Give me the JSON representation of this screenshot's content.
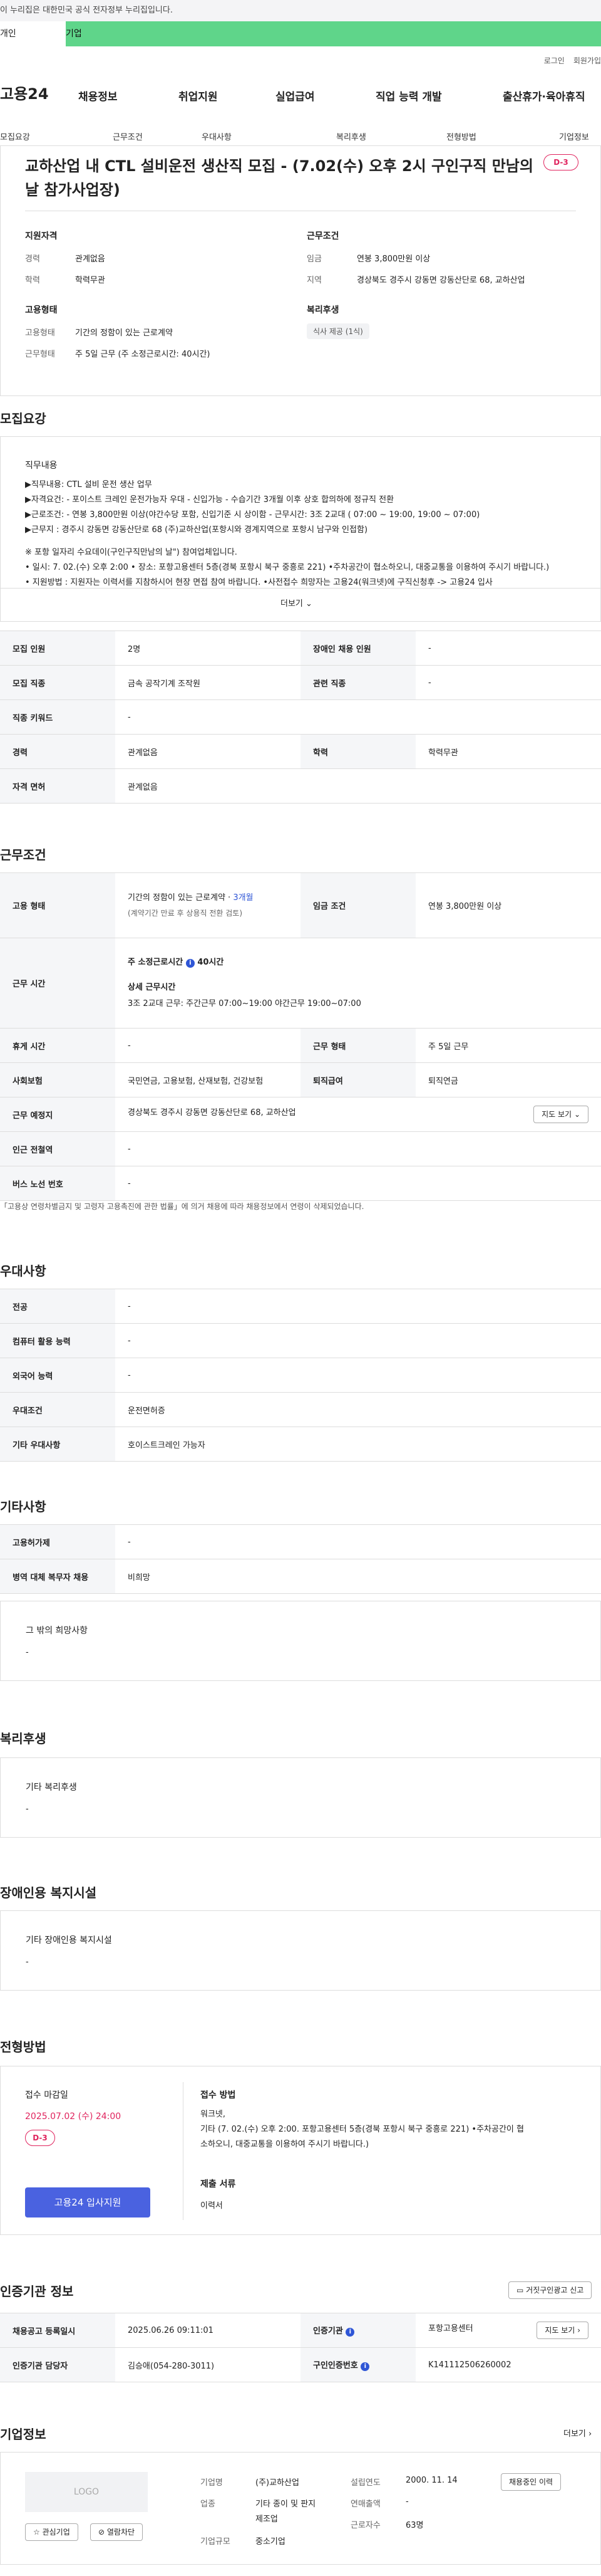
{
  "gov_banner": "이 누리집은 대한민국 공식 전자정부 누리집입니다.",
  "top_tabs": [
    "개인",
    "기업"
  ],
  "util_links": [
    "로그인",
    "회원가입"
  ],
  "logo": "고용24",
  "gnb": [
    "채용정보",
    "취업지원",
    "실업급여",
    "직업 능력 개발",
    "출산휴가·육아휴직"
  ],
  "subnav": [
    "모집요강",
    "근무조건",
    "우대사항",
    "복리후생",
    "전형방법",
    "기업정보"
  ],
  "job": {
    "title": "교하산업 내 CTL 설비운전 생산직 모집 - (7.02(수) 오후 2시 구인구직 만남의 날 참가사업장)",
    "dday": "D-3",
    "qual_head": "지원자격",
    "qual": [
      {
        "k": "경력",
        "v": "관계없음"
      },
      {
        "k": "학력",
        "v": "학력무관"
      }
    ],
    "cond_head": "근무조건",
    "cond": [
      {
        "k": "임금",
        "v": "연봉 3,800만원 이상"
      },
      {
        "k": "지역",
        "v": "경상북도 경주시 강동면 강동산단로 68, 교하산업"
      }
    ],
    "emp_head": "고용형태",
    "emp": [
      {
        "k": "고용형태",
        "v": "기간의 정함이 있는 근로계약"
      },
      {
        "k": "근무형태",
        "v": "주 5일 근무 (주 소정근로시간: 40시간)"
      }
    ],
    "welfare_head": "복리후생",
    "welfare_chip": "식사 제공 (1식)"
  },
  "recruit": {
    "title": "모집요강",
    "sub": "직무내용",
    "lines": [
      "▶직무내용: CTL 설비 운전 생산 업무",
      "▶자격요건: - 포이스트 크레인 운전가능자 우대  - 신입가능 - 수습기간 3개월 이후 상호 합의하에 정규직 전환",
      "▶근로조건: - 연봉 3,800만원 이상(야간수당 포함, 신입기준 시 상이함 - 근무시간: 3조 2교대 ( 07:00 ~ 19:00, 19:00 ~ 07:00)",
      "▶근무지 : 경주시 강동면 강동산단로 68 (주)교하산업(포항시와 경계지역으로 포항시 남구와 인접함)",
      "",
      "※ 포항 일자리 수요데이(구인구직만남의 날\") 참여업체입니다.",
      "• 일시: 7. 02.(수) 오후 2:00    • 장소: 포항고용센터  5층(경북 포항시 북구 중흥로 221)  •주차공간이 협소하오니, 대중교통을 이용하여 주시기 바랍니다.)",
      "• 지원방법 : 지원자는 이력서를  지참하시어 현장 면접 참여 바랍니다.    •사전접수 희망자는  고용24(워크넷)에 구직신청후 -> 고용24 입사"
    ],
    "more": "더보기",
    "rows": [
      [
        {
          "k": "모집 인원",
          "v": "2명"
        },
        {
          "k": "장애인 채용 인원",
          "v": "-"
        }
      ],
      [
        {
          "k": "모집 직종",
          "v": "금속 공작기계 조작원"
        },
        {
          "k": "관련 직종",
          "v": "-"
        }
      ],
      [
        {
          "k": "직종 키워드",
          "v": "-"
        }
      ],
      [
        {
          "k": "경력",
          "v": "관계없음"
        },
        {
          "k": "학력",
          "v": "학력무관"
        }
      ],
      [
        {
          "k": "자격 면허",
          "v": "관계없음"
        }
      ]
    ]
  },
  "work": {
    "title": "근무조건",
    "emp_k": "고용 형태",
    "emp_v1": "기간의 정함이 있는 근로계약 · ",
    "emp_v1b": "3개월",
    "emp_v2": "(계약기간 만료 후 상용직 전환 검토)",
    "wage_k": "임금 조건",
    "wage_v": "연봉 3,800만원 이상",
    "time_k": "근무 시간",
    "time_h1": "주 소정근로시간",
    "time_h1v": "40시간",
    "time_h2": "상세 근무시간",
    "time_v": "3조 2교대 근무:  주간근무 07:00~19:00  야간근무 19:00~07:00",
    "rest_k": "휴게 시간",
    "rest_v": "-",
    "form_k": "근무 형태",
    "form_v": "주 5일 근무",
    "ins_k": "사회보험",
    "ins_v": "국민연금, 고용보험, 산재보험, 건강보험",
    "ret_k": "퇴직급여",
    "ret_v": "퇴직연금",
    "place_k": "근무 예정지",
    "place_v": "경상북도 경주시 강동면 강동산단로 68, 교하산업",
    "map_btn": "지도 보기",
    "subway_k": "인근 전철역",
    "subway_v": "-",
    "bus_k": "버스 노선 번호",
    "bus_v": "-",
    "note": "「고용상 연령차별금지 및 고령자 고용촉진에 관한 법률」에 의거 채용에 따라 채용정보에서 연령이 삭제되었습니다."
  },
  "pref": {
    "title": "우대사항",
    "rows": [
      {
        "k": "전공",
        "v": "-"
      },
      {
        "k": "컴퓨터 활용 능력",
        "v": "-"
      },
      {
        "k": "외국어 능력",
        "v": "-"
      },
      {
        "k": "우대조건",
        "v": "운전면허증"
      },
      {
        "k": "기타 우대사항",
        "v": "호이스트크레인 가능자"
      }
    ]
  },
  "etc": {
    "title": "기타사항",
    "rows": [
      {
        "k": "고용허가제",
        "v": "-"
      },
      {
        "k": "병역 대체 복무자 채용",
        "v": "비희망"
      }
    ],
    "box_title": "그 밖의 희망사항",
    "box_v": "-"
  },
  "welfare": {
    "title": "복리후생",
    "box_title": "기타 복리후생",
    "box_v": "-"
  },
  "disabled": {
    "title": "장애인용 복지시설",
    "box_title": "기타 장애인용 복지시설",
    "box_v": "-"
  },
  "process": {
    "title": "전형방법",
    "deadline_k": "접수 마감일",
    "deadline_v": "2025.07.02 (수) 24:00",
    "dday": "D-3",
    "apply_btn": "고용24 입사지원",
    "method_k": "접수 방법",
    "method_v1": "워크넷,",
    "method_v2": "기타 (7. 02.(수) 오후 2:00.  포항고용센터 5층(경북 포항시 북구 중흥로 221)  •주차공간이 협",
    "method_v3": "소하오니, 대중교통을 이용하여 주시기 바랍니다.)",
    "docs_k": "제출 서류",
    "docs_v": "이력서"
  },
  "cert": {
    "title": "인증기관 정보",
    "report_btn": "거짓구인광고 신고",
    "rows": [
      [
        {
          "k": "채용공고 등록일시",
          "v": "2025.06.26 09:11:01"
        },
        {
          "k": "인증기관",
          "v": "포항고용센터"
        }
      ],
      [
        {
          "k": "인증기관 담당자",
          "v": "김승애(054-280-3011)"
        },
        {
          "k": "구인인증번호",
          "v": "K141112506260002"
        }
      ]
    ],
    "map_btn": "지도 보기"
  },
  "company": {
    "title": "기업정보",
    "more": "더보기",
    "logo": "LOGO",
    "fav": "관심기업",
    "block": "열람차단",
    "name_k": "기업명",
    "name_v": "(주)교하산업",
    "ind_k": "업종",
    "ind_v1": "기타 종이 및 판지",
    "ind_v2": "제조업",
    "size_k": "기업규모",
    "size_v": "중소기업",
    "found_k": "설립연도",
    "found_v": "2000. 11. 14",
    "sales_k": "연매출액",
    "sales_v": "-",
    "emp_k": "근로자수",
    "emp_v": "63명",
    "jobs_btn": "채용중인 이력"
  }
}
